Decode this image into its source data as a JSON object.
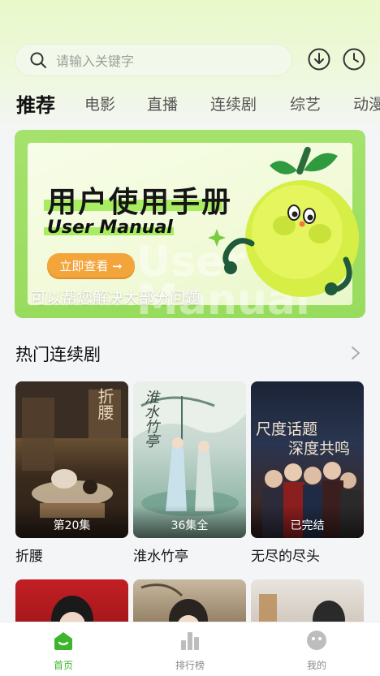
{
  "search": {
    "placeholder": "请输入关键字"
  },
  "header_icons": [
    "download-icon",
    "history-clock-icon"
  ],
  "tabs": [
    {
      "label": "推荐",
      "active": true
    },
    {
      "label": "电影",
      "active": false
    },
    {
      "label": "直播",
      "active": false
    },
    {
      "label": "连续剧",
      "active": false
    },
    {
      "label": "综艺",
      "active": false
    },
    {
      "label": "动漫",
      "active": false
    }
  ],
  "banner": {
    "title": "用户使用手册",
    "subtitle": "User Manual",
    "watermark": "User Manual",
    "button_label": "立即查看 ➞",
    "caption": "可以帮您解决大部分问题"
  },
  "section": {
    "title": "热门连续剧",
    "more_icon": "chevron-right-icon"
  },
  "dramas": [
    {
      "title": "折腰",
      "badge": "第20集"
    },
    {
      "title": "淮水竹亭",
      "badge": "36集全"
    },
    {
      "title": "无尽的尽头",
      "badge": "已完结"
    }
  ],
  "poster_texts": {
    "p1_overlay": "折腰",
    "p2_overlay": "淮水竹亭",
    "p3_line1": "尺度话题",
    "p3_line2": "深度共鸣"
  },
  "bottom_nav": [
    {
      "label": "首页",
      "icon": "home-icon",
      "active": true
    },
    {
      "label": "排行榜",
      "icon": "bar-chart-icon",
      "active": false
    },
    {
      "label": "我的",
      "icon": "profile-face-icon",
      "active": false
    }
  ],
  "colors": {
    "accent": "#3fb52f",
    "banner_bg": "#a4e26c",
    "banner_button": "#f3a43b"
  }
}
